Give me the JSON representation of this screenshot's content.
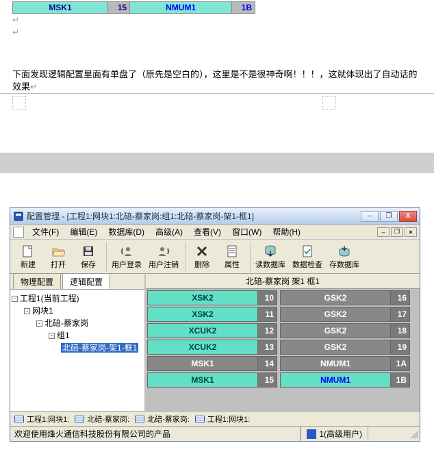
{
  "top_row": {
    "l_label": "MSK1",
    "l_num": "15",
    "r_label": "NMUM1",
    "r_num": "1B"
  },
  "body_text": "下面发现逻辑配置里面有单盘了（原先是空白的），这里是不是很神奇啊！！！，这就体现出了自动话的效果",
  "window": {
    "title": "配置管理 - [工程1:网块1:北碚-蔡家岗:组1:北碚-蔡家岗-架1-框1]",
    "menus": {
      "file": "文件(F)",
      "edit": "编辑(E)",
      "db": "数据库(D)",
      "adv": "高级(A)",
      "view": "查看(V)",
      "window": "窗口(W)",
      "help": "帮助(H)"
    },
    "toolbar": {
      "new": "新建",
      "open": "打开",
      "save": "保存",
      "login": "用户登录",
      "logout": "用户注销",
      "delete": "删除",
      "prop": "属性",
      "readdb": "读数据库",
      "checkdata": "数据检查",
      "savedb": "存数据库"
    },
    "lefttabs": {
      "phys": "物理配置",
      "logic": "逻辑配置"
    },
    "tree": {
      "n0": "工程1(当前工程)",
      "n1": "网块1",
      "n2": "北碚-蔡家岗",
      "n3": "组1",
      "n4": "北碚-蔡家岗-架1-框1"
    },
    "rack_header": "北碚-蔡家岗 架1 框1",
    "rack": [
      {
        "l": "XSK2",
        "ln": "10",
        "r": "GSK2",
        "rn": "16",
        "lc": "teal",
        "rc": "gray"
      },
      {
        "l": "XSK2",
        "ln": "11",
        "r": "GSK2",
        "rn": "17",
        "lc": "teal",
        "rc": "gray"
      },
      {
        "l": "XCUK2",
        "ln": "12",
        "r": "GSK2",
        "rn": "18",
        "lc": "teal",
        "rc": "gray"
      },
      {
        "l": "XCUK2",
        "ln": "13",
        "r": "GSK2",
        "rn": "19",
        "lc": "teal",
        "rc": "gray"
      },
      {
        "l": "MSK1",
        "ln": "14",
        "r": "NMUM1",
        "rn": "1A",
        "lc": "gray",
        "rc": "gray"
      },
      {
        "l": "MSK1",
        "ln": "15",
        "r": "NMUM1",
        "rn": "1B",
        "lc": "teal",
        "rc": "teal nmum"
      }
    ],
    "bottom_tabs": {
      "t1": "工程1:网块1:",
      "t2": "北碚-蔡家岗:",
      "t3": "北碚-蔡家岗:",
      "t4": "工程1:网块1:"
    },
    "status_left": "欢迎使用烽火通信科技股份有限公司的产品",
    "status_user": "1(高级用户)"
  }
}
